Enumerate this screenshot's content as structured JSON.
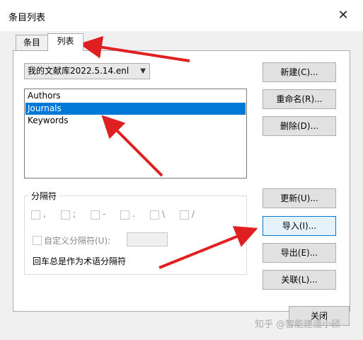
{
  "window": {
    "title": "条目列表",
    "close": "✕"
  },
  "tabs": [
    {
      "label": "条目"
    },
    {
      "label": "列表"
    }
  ],
  "library_select": {
    "value": "我的文献库2022.5.14.enl"
  },
  "lists": [
    {
      "label": "Authors",
      "selected": false
    },
    {
      "label": "Journals",
      "selected": true
    },
    {
      "label": "Keywords",
      "selected": false
    }
  ],
  "buttons": {
    "new": "新建(C)...",
    "rename": "重命名(R)...",
    "delete": "删除(D)...",
    "update": "更新(U)...",
    "import": "导入(I)...",
    "export": "导出(E)...",
    "link": "关联(L)...",
    "close": "关闭"
  },
  "separators": {
    "group_label": "分隔符",
    "items": [
      ",",
      ";",
      "-",
      ".",
      "\\",
      "/"
    ],
    "custom_label": "自定义分隔符(U):",
    "custom_value": "",
    "note": "回车总是作为术语分隔符"
  },
  "watermark": "知乎 @智能建造小硕",
  "colors": {
    "selection": "#0078d7",
    "annotation_arrow": "#e02020"
  }
}
